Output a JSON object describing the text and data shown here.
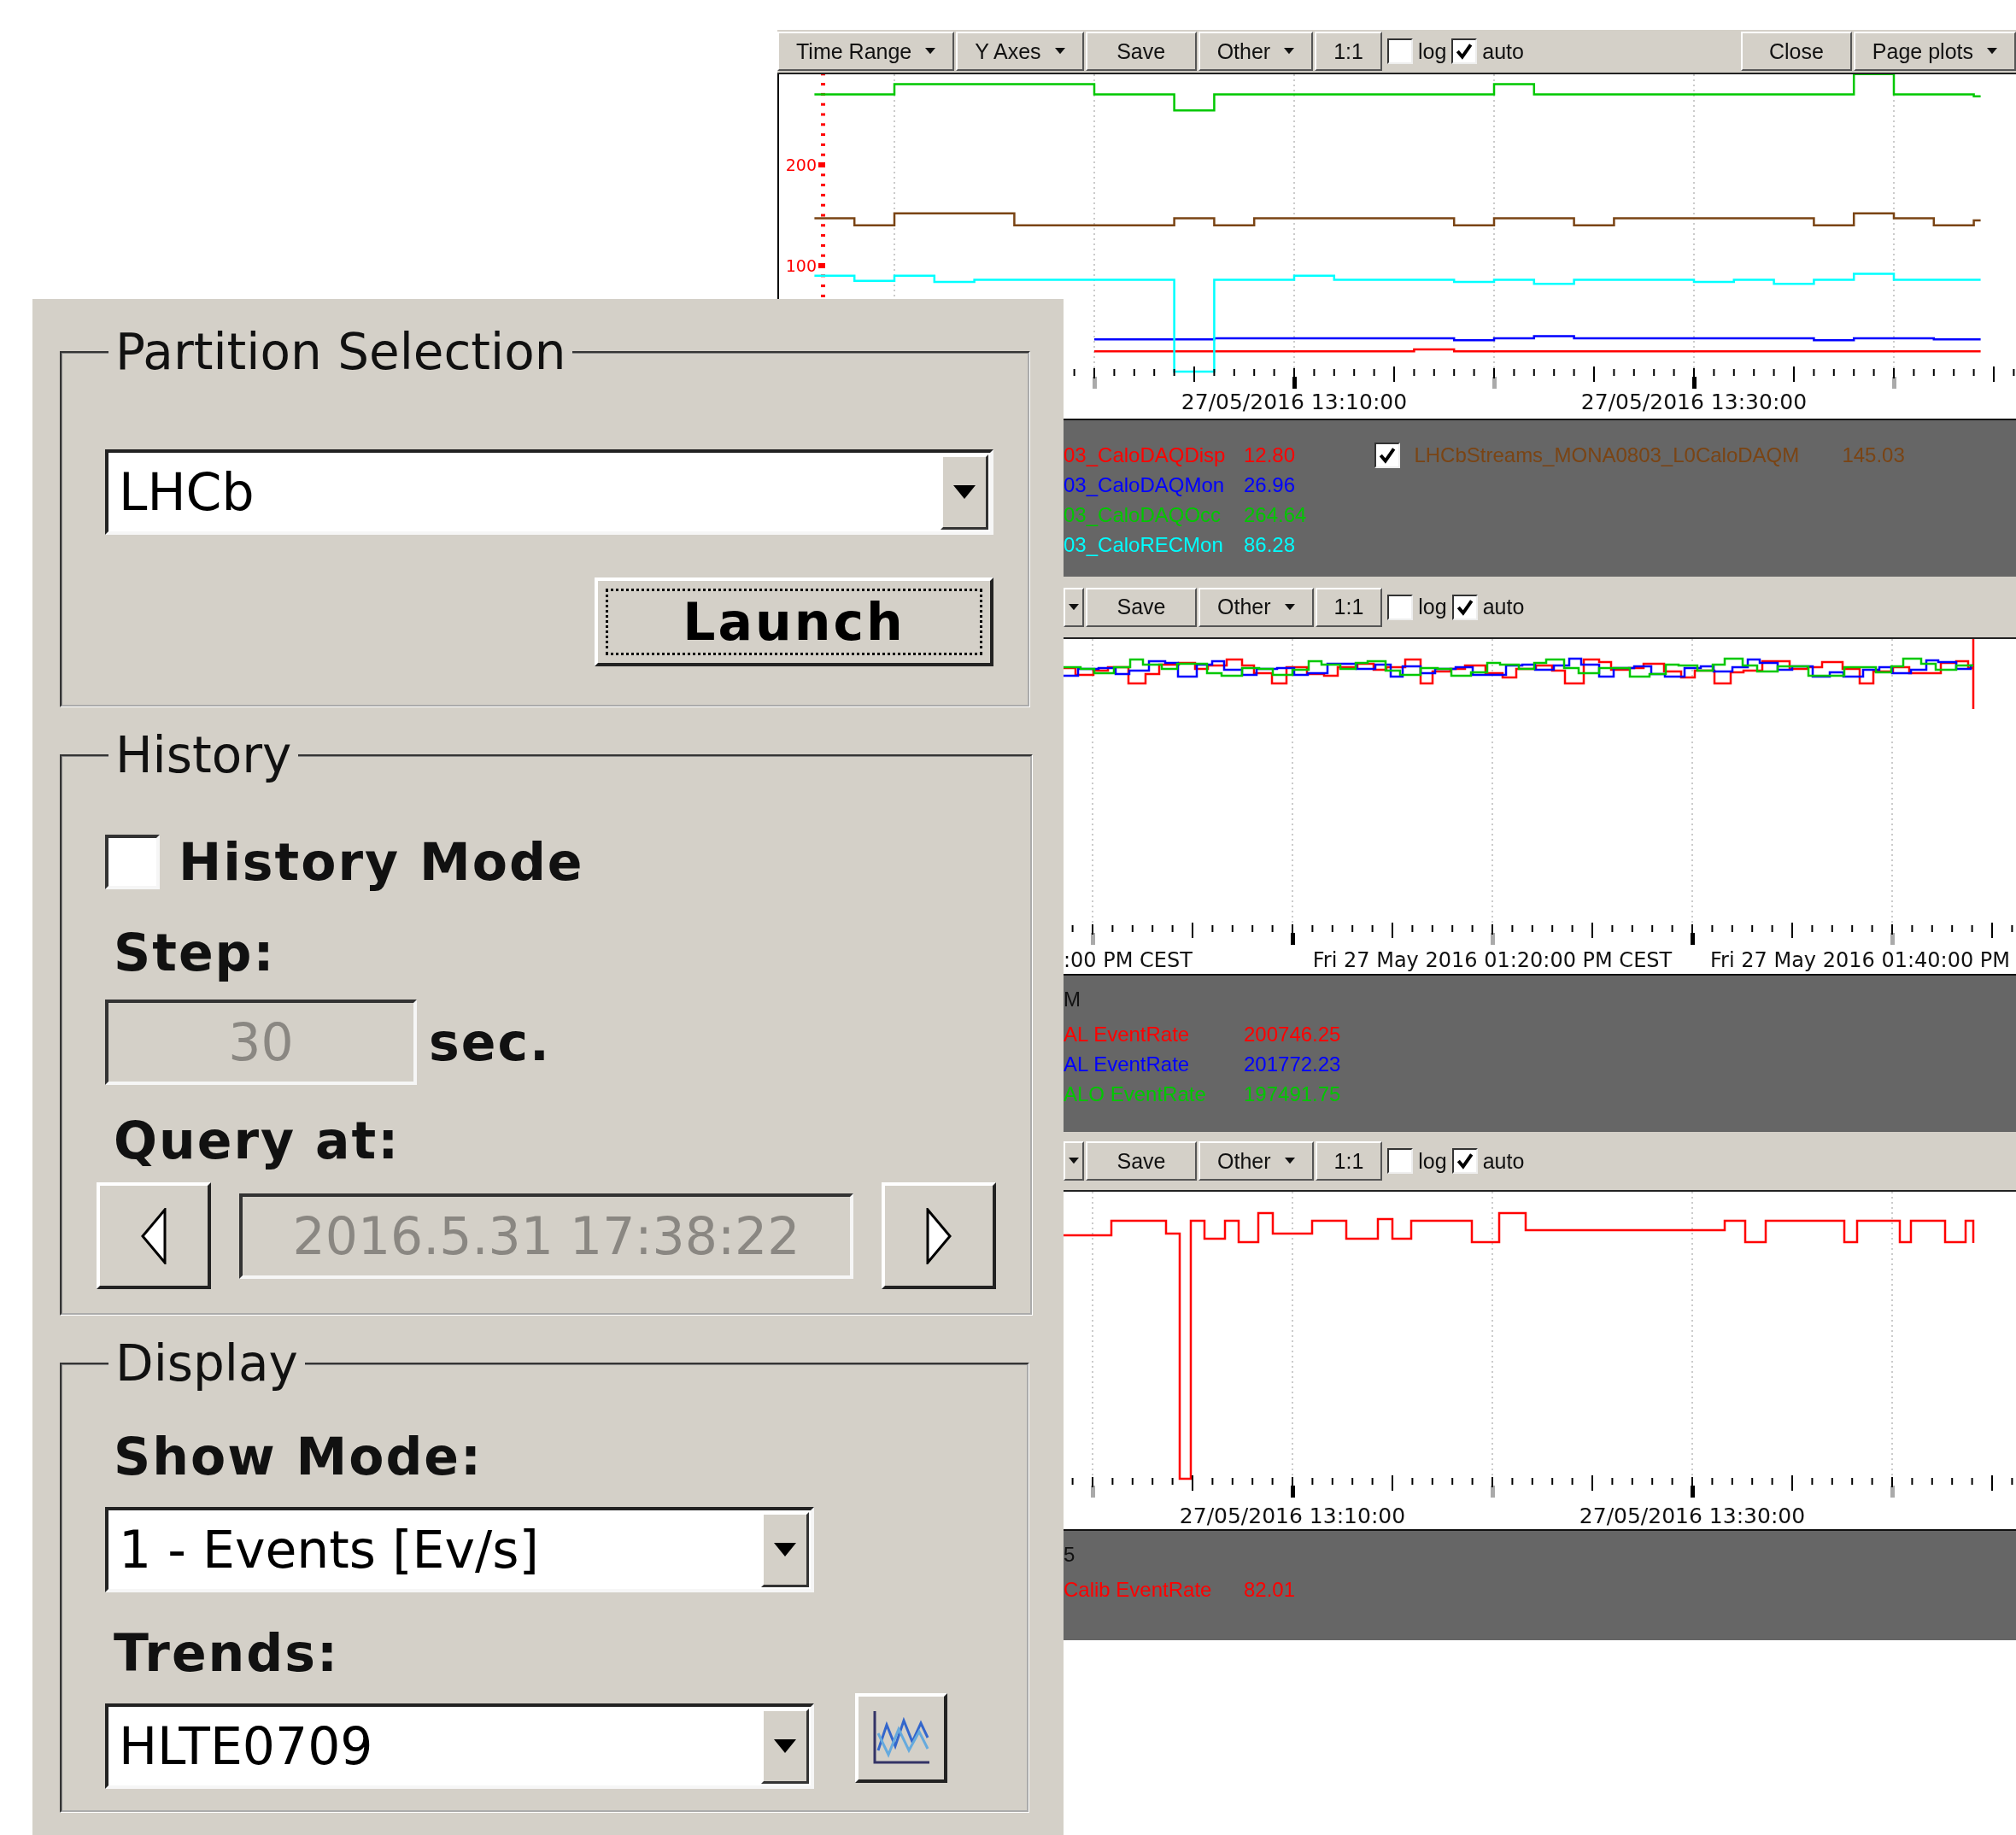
{
  "trend_window": {
    "plots": [
      {
        "toolbar": {
          "items": [
            {
              "kind": "dropdown",
              "label": "Time Range"
            },
            {
              "kind": "dropdown",
              "label": "Y Axes"
            },
            {
              "kind": "button",
              "label": "Save"
            },
            {
              "kind": "dropdown",
              "label": "Other"
            },
            {
              "kind": "button",
              "label": "1:1"
            },
            {
              "kind": "checkbox",
              "label": "log",
              "checked": false
            },
            {
              "kind": "checkbox",
              "label": "auto",
              "checked": true
            }
          ],
          "right_items": [
            {
              "kind": "button",
              "label": "Close"
            },
            {
              "kind": "dropdown",
              "label": "Page plots"
            }
          ]
        },
        "y_axis_labels": [
          "200",
          "100"
        ],
        "axis_labels": [
          "27/05/2016 13:10:00",
          "27/05/2016 13:30:00"
        ],
        "legend": {
          "entries": [
            {
              "kind": "plain",
              "name": "03_CaloDAQDisp",
              "value": "12.80",
              "color": "#ff0000"
            },
            {
              "kind": "plain",
              "name": "03_CaloDAQMon",
              "value": "26.96",
              "color": "#0000ff"
            },
            {
              "kind": "plain",
              "name": "03_CaloDAQOcc",
              "value": "264.64",
              "color": "#00c800"
            },
            {
              "kind": "plain",
              "name": "03_CaloRECMon",
              "value": "86.28",
              "color": "#00ffff"
            },
            {
              "kind": "checkbox",
              "checked": true,
              "name": "LHCbStreams_MONA0803_L0CaloDAQM",
              "value": "145.03",
              "color": "#7a4414"
            }
          ]
        }
      },
      {
        "toolbar": {
          "items": [
            {
              "kind": "dropdown_stub"
            },
            {
              "kind": "button",
              "label": "Save"
            },
            {
              "kind": "dropdown",
              "label": "Other"
            },
            {
              "kind": "button",
              "label": "1:1"
            },
            {
              "kind": "checkbox",
              "label": "log",
              "checked": false
            },
            {
              "kind": "checkbox",
              "label": "auto",
              "checked": true
            }
          ]
        },
        "axis_labels": [
          ":00 PM CEST",
          "Fri 27 May 2016 01:20:00 PM CEST",
          "Fri 27 May 2016 01:40:00 PM"
        ],
        "legend": {
          "title": "M",
          "entries": [
            {
              "kind": "plain",
              "name": "AL EventRate",
              "value": "200746.25",
              "color": "#ff0000"
            },
            {
              "kind": "plain",
              "name": "AL EventRate",
              "value": "201772.23",
              "color": "#0000ff"
            },
            {
              "kind": "plain",
              "name": "ALO EventRate",
              "value": "197491.75",
              "color": "#00c800"
            }
          ]
        }
      },
      {
        "toolbar": {
          "items": [
            {
              "kind": "dropdown_stub"
            },
            {
              "kind": "button",
              "label": "Save"
            },
            {
              "kind": "dropdown",
              "label": "Other"
            },
            {
              "kind": "button",
              "label": "1:1"
            },
            {
              "kind": "checkbox",
              "label": "log",
              "checked": false
            },
            {
              "kind": "checkbox",
              "label": "auto",
              "checked": true
            }
          ]
        },
        "axis_labels": [
          "27/05/2016 13:10:00",
          "27/05/2016 13:30:00"
        ],
        "legend": {
          "title": "5",
          "entries": [
            {
              "kind": "plain",
              "name": "Calib EventRate",
              "value": "82.01",
              "color": "#ff0000"
            }
          ]
        }
      }
    ]
  },
  "control_panel": {
    "partition": {
      "title": "Partition Selection",
      "selection": "LHCb",
      "launch_label": "Launch"
    },
    "history": {
      "title": "History",
      "mode_label": "History Mode",
      "history_mode": false,
      "step_label": "Step:",
      "step_value": "30",
      "step_unit": "sec.",
      "query_label": "Query at:",
      "query_value": "2016.5.31 17:38:22"
    },
    "display": {
      "title": "Display",
      "show_mode_label": "Show Mode:",
      "show_mode": "1 - Events [Ev/s]",
      "trends_label": "Trends:",
      "trends": "HLTE0709"
    }
  }
}
